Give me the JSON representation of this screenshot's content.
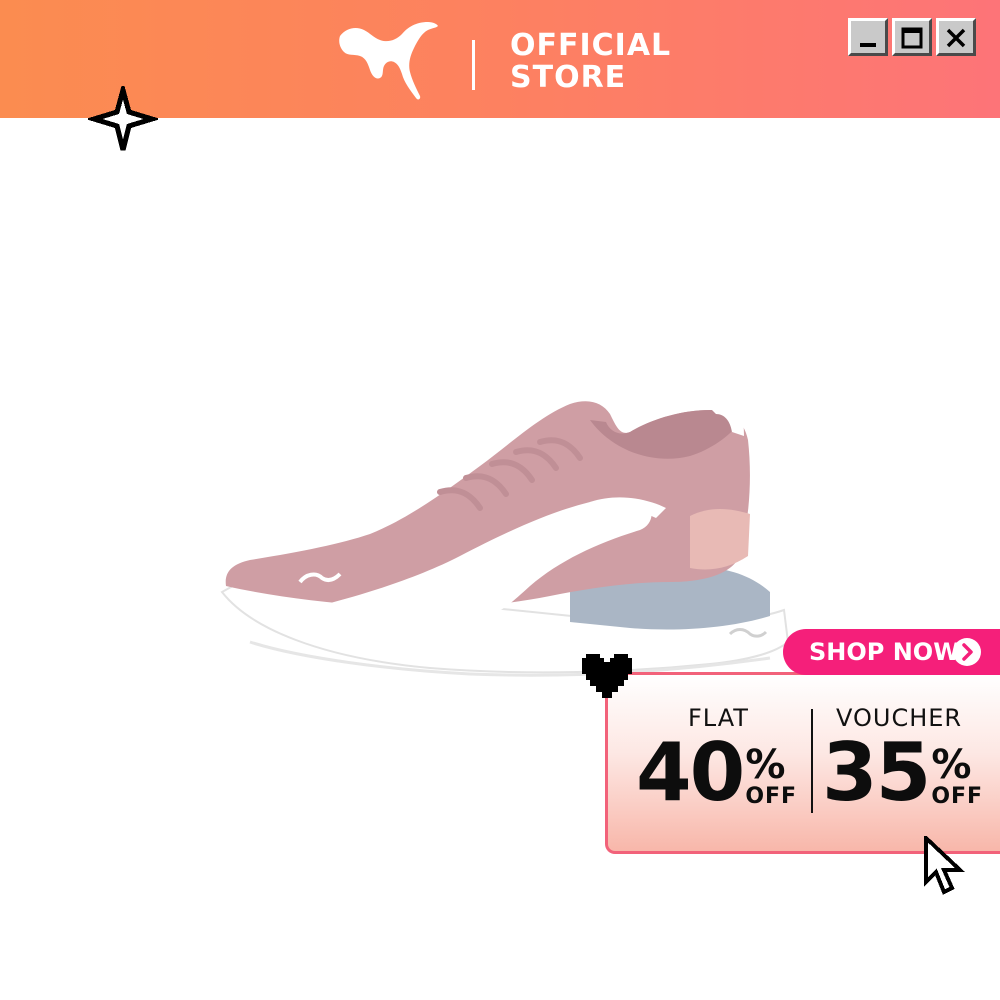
{
  "header": {
    "official_line1": "OFFICIAL",
    "official_line2": "STORE",
    "colors": {
      "gradient_start": "#fb8c50",
      "gradient_end": "#fd7478"
    }
  },
  "window_controls": {
    "icons": [
      "minimize-icon",
      "maximize-icon",
      "close-icon"
    ]
  },
  "product": {
    "image": "pink-sneaker",
    "colors": {
      "upper": "#cf9ea4",
      "stripe": "#ffffff",
      "sole_accent": "#a9b6c4"
    }
  },
  "shop_button": {
    "label": "SHOP NOW",
    "color": "#f51f7a"
  },
  "promo": {
    "flat": {
      "label": "FLAT",
      "value": "40",
      "percent": "%",
      "off": "OFF"
    },
    "voucher": {
      "label": "VOUCHER",
      "value": "35",
      "percent": "%",
      "off": "OFF"
    }
  },
  "decorations": [
    "sparkle-icon",
    "heart-icon",
    "cursor-icon"
  ]
}
